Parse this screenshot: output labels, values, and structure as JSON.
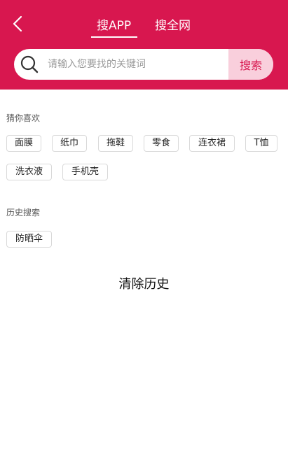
{
  "header": {
    "tabs": [
      {
        "label": "搜APP",
        "active": true
      },
      {
        "label": "搜全网",
        "active": false
      }
    ],
    "accent_color": "#d8174f"
  },
  "search": {
    "placeholder": "请输入您要找的关键词",
    "value": "",
    "button_label": "搜索"
  },
  "recommend": {
    "title": "猜你喜欢",
    "items": [
      "面膜",
      "纸巾",
      "拖鞋",
      "零食",
      "连衣裙",
      "T恤",
      "洗衣液",
      "手机壳"
    ]
  },
  "history": {
    "title": "历史搜索",
    "items": [
      "防晒伞"
    ],
    "clear_label": "清除历史"
  }
}
